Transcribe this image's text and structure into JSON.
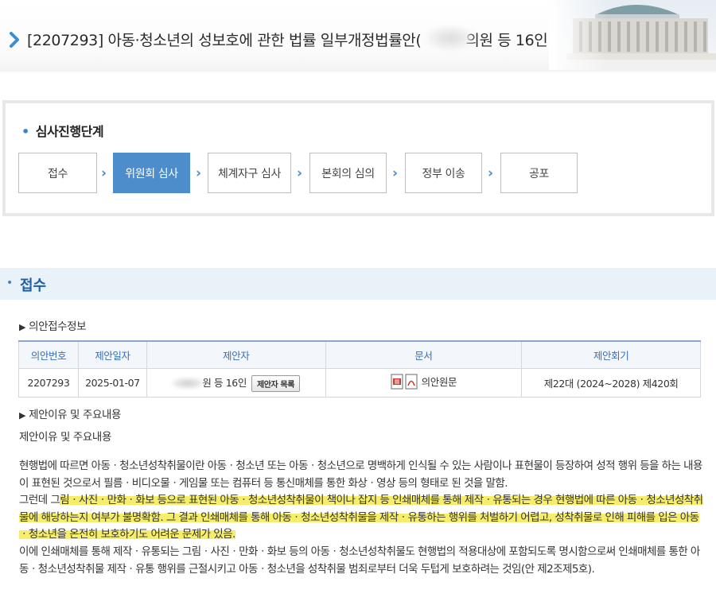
{
  "header": {
    "bill_title": "[2207293] 아동·청소년의 성보호에 관한 법률 일부개정법률안(",
    "bill_title_suffix": "의원 등 16인)"
  },
  "stage": {
    "title": "심사진행단계",
    "steps": [
      "접수",
      "위원회 심사",
      "체계자구 심사",
      "본회의 심의",
      "정부 이송",
      "공포"
    ],
    "active_step": "위원회 심사"
  },
  "section": {
    "title": "접수",
    "info_heading": "의안접수정보",
    "reason_heading": "제안이유 및 주요내용"
  },
  "table": {
    "headers": [
      "의안번호",
      "제안일자",
      "제안자",
      "문서",
      "제안회기"
    ],
    "row": {
      "bill_no": "2207293",
      "date": "2025-01-07",
      "proposer": "원 등 16인",
      "proposer_button": "제안자 목록",
      "document": "의안원문",
      "session": "제22대 (2024~2028) 제420회"
    }
  },
  "reason_label": "제안이유 및 주요내용",
  "body": {
    "p1": "현행법에 따르면 아동ㆍ청소년성착취물이란 아동ㆍ청소년 또는 아동ㆍ청소년으로 명백하게 인식될 수 있는 사람이나 표현물이 등장하여 성적 행위 등을 하는 내용이 표현된 것으로서 필름ㆍ비디오물ㆍ게임물 또는 컴퓨터 등 통신매체를 통한 화상ㆍ영상 등의 형태로 된 것을 말함.",
    "p2_plain": "그런데 그",
    "p2_highlight": "림ㆍ사진ㆍ만화ㆍ화보 등으로 표현된 아동ㆍ청소년성착취물이 책이나 잡지 등 인쇄매체를 통해 제작ㆍ유통되는 경우 현행법에 따른 아동ㆍ청소년성착취물에 해당하는지 여부가 불명확함. 그 결과 인쇄매체를 통해 아동ㆍ청소년성착취물을 제작ㆍ유통하는 행위를 처벌하기 어렵고, 성착취물로 인해 피해를 입은 아동ㆍ청소년을 온전히 보호하기도 어려운 문제가 있음.",
    "p3": "이에 인쇄매체를 통해 제작ㆍ유통되는 그림ㆍ사진ㆍ만화ㆍ화보 등의 아동ㆍ청소년성착취물도 현행법의 적용대상에 포함되도록 명시함으로써 인쇄매체를 통한 아동ㆍ청소년성착취물 제작ㆍ유통 행위를 근절시키고 아동ㆍ청소년을 성착취물 범죄로부터 더욱 두텁게 보호하려는 것임(안 제2조제5호)."
  },
  "colors": {
    "accent_blue": "#4d8dcc",
    "section_bg": "#e9f1f9",
    "highlight": "#f6ee6a"
  },
  "icons": [
    "chevron-right-icon",
    "hwp-file-icon",
    "pdf-file-icon",
    "assembly-building-image"
  ]
}
